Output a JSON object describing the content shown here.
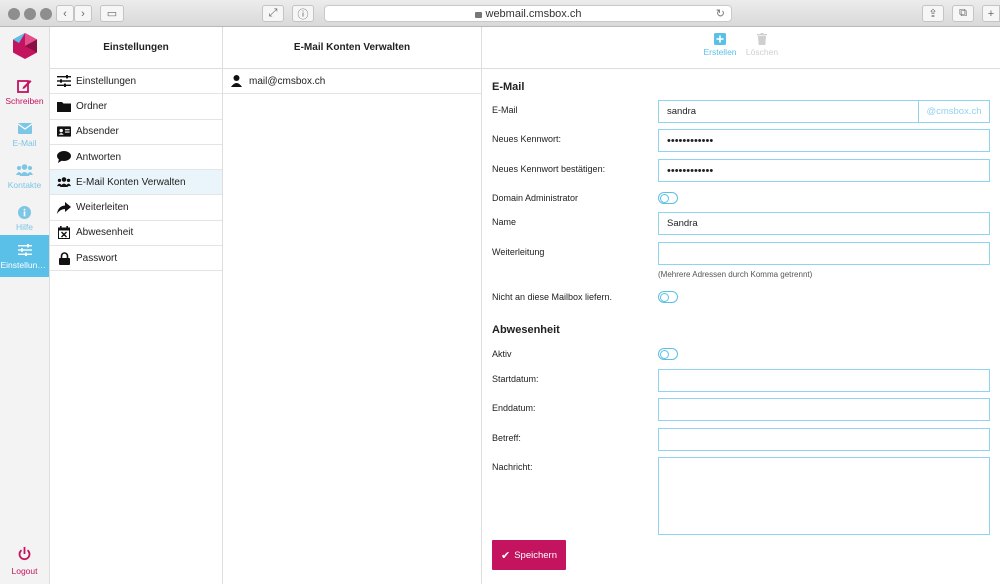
{
  "browser": {
    "url": "webmail.cmsbox.ch"
  },
  "rail": {
    "items": [
      {
        "label": "Schreiben",
        "icon": "compose-icon"
      },
      {
        "label": "E-Mail",
        "icon": "mail-icon"
      },
      {
        "label": "Kontakte",
        "icon": "contacts-icon"
      },
      {
        "label": "Hilfe",
        "icon": "info-icon"
      },
      {
        "label": "Einstellung...",
        "icon": "sliders-icon"
      }
    ],
    "logout": "Logout"
  },
  "settings_column": {
    "title": "Einstellungen",
    "items": [
      {
        "label": "Einstellungen",
        "icon": "sliders-icon"
      },
      {
        "label": "Ordner",
        "icon": "folder-icon"
      },
      {
        "label": "Absender",
        "icon": "id-card-icon"
      },
      {
        "label": "Antworten",
        "icon": "speech-bubble-icon"
      },
      {
        "label": "E-Mail Konten Verwalten",
        "icon": "users-icon"
      },
      {
        "label": "Weiterleiten",
        "icon": "forward-arrow-icon"
      },
      {
        "label": "Abwesenheit",
        "icon": "calendar-x-icon"
      },
      {
        "label": "Passwort",
        "icon": "lock-icon"
      }
    ]
  },
  "accounts_column": {
    "title": "E-Mail Konten Verwalten",
    "accounts": [
      "mail@cmsbox.ch"
    ]
  },
  "toolbar": {
    "create": "Erstellen",
    "delete": "Löschen"
  },
  "form": {
    "email_section": "E-Mail",
    "email_label": "E-Mail",
    "email_value": "sandra",
    "email_domain": "@cmsbox.ch",
    "new_password_label": "Neues Kennwort:",
    "new_password_value": "••••••••••••",
    "confirm_password_label": "Neues Kennwort bestätigen:",
    "confirm_password_value": "••••••••••••",
    "domain_admin_label": "Domain Administrator",
    "name_label": "Name",
    "name_value": "Sandra",
    "forward_label": "Weiterleitung",
    "forward_value": "",
    "forward_hint": "(Mehrere Adressen durch Komma getrennt)",
    "no_deliver_label": "Nicht an diese Mailbox liefern.",
    "absence_section": "Abwesenheit",
    "active_label": "Aktiv",
    "start_label": "Startdatum:",
    "end_label": "Enddatum:",
    "subject_label": "Betreff:",
    "message_label": "Nachricht:",
    "save_label": "Speichern"
  },
  "colors": {
    "accent": "#5bc0e8",
    "brand": "#c4145f"
  }
}
